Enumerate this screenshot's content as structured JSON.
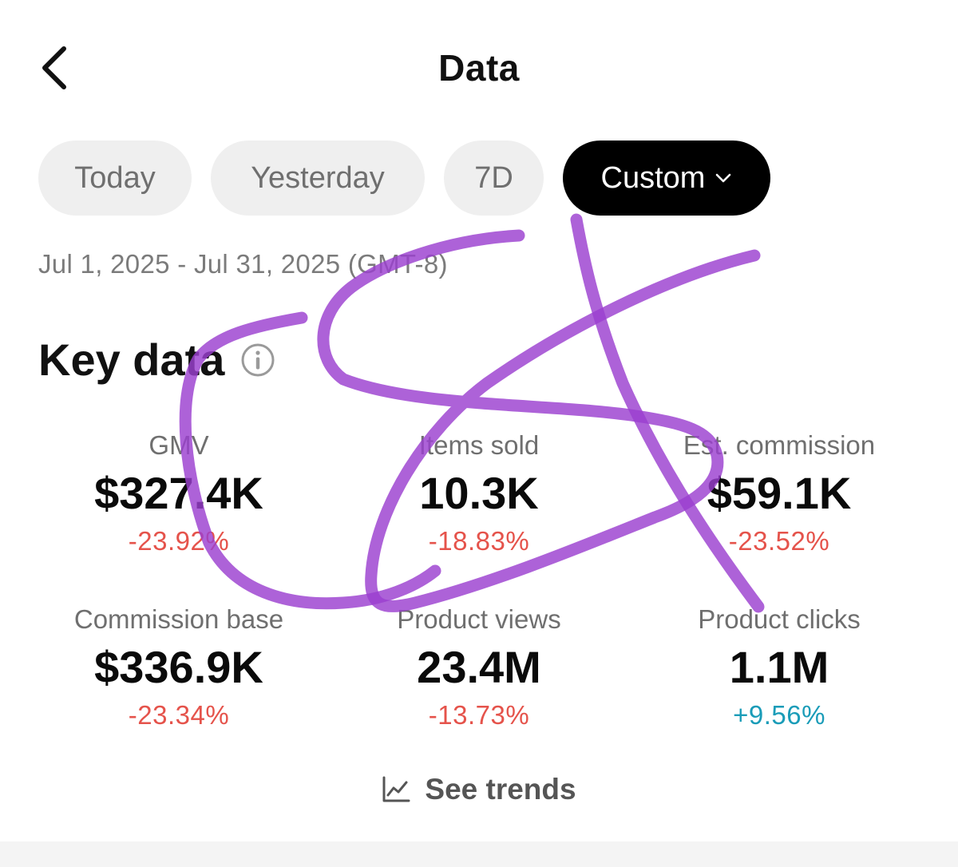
{
  "header": {
    "title": "Data",
    "back_icon": "chevron-left-icon"
  },
  "filters": {
    "today": "Today",
    "yesterday": "Yesterday",
    "seven_days": "7D",
    "custom": "Custom",
    "selected": "Custom"
  },
  "date_range": "Jul 1, 2025 - Jul 31, 2025 (GMT-8)",
  "key_data": {
    "title": "Key data",
    "metrics": [
      {
        "label": "GMV",
        "value": "$327.4K",
        "change": "-23.92%",
        "trend": "negative"
      },
      {
        "label": "Items sold",
        "value": "10.3K",
        "change": "-18.83%",
        "trend": "negative"
      },
      {
        "label": "Est. commission",
        "value": "$59.1K",
        "change": "-23.52%",
        "trend": "negative"
      },
      {
        "label": "Commission base",
        "value": "$336.9K",
        "change": "-23.34%",
        "trend": "negative"
      },
      {
        "label": "Product views",
        "value": "23.4M",
        "change": "-13.73%",
        "trend": "negative"
      },
      {
        "label": "Product clicks",
        "value": "1.1M",
        "change": "+9.56%",
        "trend": "positive"
      }
    ]
  },
  "see_trends": "See trends",
  "colors": {
    "negative": "#e5534b",
    "positive": "#1a9cb8",
    "chip_active_bg": "#000000",
    "chip_bg": "#efefef",
    "scribble": "#9b3fd0"
  }
}
